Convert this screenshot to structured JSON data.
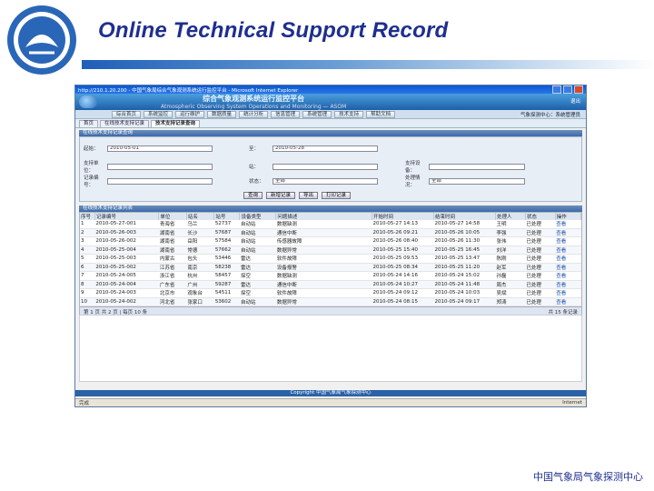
{
  "slide": {
    "title": "Online Technical Support Record",
    "footer": "中国气象局气象探测中心"
  },
  "colors": {
    "title": "#1f2f8f",
    "header": "#1e5fa8",
    "rule": "#1f5fb8"
  },
  "browser": {
    "title": "http://210.1.20.200 - 中国气象局综合气象观测系统运行监控平台 - Microsoft Internet Explorer"
  },
  "app": {
    "name_cn": "综合气象观测系统运行监控平台",
    "name_en": "Atmospheric Observing System Operations and Monitoring — ASOM",
    "logout": "退出",
    "menu": [
      "综合首页",
      "系统监控",
      "运行维护",
      "数据质量",
      "统计分析",
      "信息管理",
      "系统管理",
      "技术支持",
      "帮助文档"
    ],
    "user": "气象探测中心：系统管理员",
    "tabs": [
      "首页",
      "在线技术支持记录",
      "技术支持记录查询"
    ]
  },
  "form": {
    "header": "在线技术支持记录查询",
    "rows": [
      {
        "l1": "起始：",
        "v1": "2010-05-01",
        "l2": "至：",
        "v2": "2010-05-28"
      },
      {
        "l1": "支持单位：",
        "v1": "",
        "l2": "站：",
        "v2": "",
        "l3": "支持设备：",
        "v3": ""
      },
      {
        "l1": "记录编号：",
        "v1": "",
        "l2": "状态：",
        "v2": "全部",
        "l3": "处理情况：",
        "v3": "全部"
      }
    ],
    "buttons": [
      "查询",
      "新增记录",
      "导出",
      "打印记录"
    ]
  },
  "grid": {
    "header": "在线技术支持记录列表",
    "columns": [
      "序号",
      "记录编号",
      "单位",
      "站名",
      "站号",
      "设备类型",
      "问题描述",
      "开始时间",
      "结束时间",
      "处理人",
      "状态",
      "操作"
    ],
    "rows": [
      [
        "1",
        "2010-05-27-001",
        "青海省",
        "乌兰",
        "52737",
        "自动站",
        "数据缺测",
        "2010-05-27 14:13",
        "2010-05-27 14:58",
        "王明",
        "已处理",
        "查看"
      ],
      [
        "2",
        "2010-05-26-003",
        "湖南省",
        "长沙",
        "57687",
        "自动站",
        "通信中断",
        "2010-05-26 09:21",
        "2010-05-26 10:05",
        "李强",
        "已处理",
        "查看"
      ],
      [
        "3",
        "2010-05-26-002",
        "湖南省",
        "岳阳",
        "57584",
        "自动站",
        "传感器故障",
        "2010-05-26 08:40",
        "2010-05-26 11:30",
        "张伟",
        "已处理",
        "查看"
      ],
      [
        "4",
        "2010-05-25-004",
        "湖南省",
        "常德",
        "57662",
        "自动站",
        "数据异常",
        "2010-05-25 15:40",
        "2010-05-25 16:45",
        "刘洋",
        "已处理",
        "查看"
      ],
      [
        "5",
        "2010-05-25-003",
        "内蒙古",
        "包头",
        "53446",
        "雷达",
        "软件故障",
        "2010-05-25 09:53",
        "2010-05-25 13:47",
        "陈刚",
        "已处理",
        "查看"
      ],
      [
        "6",
        "2010-05-25-002",
        "江苏省",
        "南京",
        "58238",
        "雷达",
        "设备报警",
        "2010-05-25 08:34",
        "2010-05-25 11:20",
        "赵军",
        "已处理",
        "查看"
      ],
      [
        "7",
        "2010-05-24-005",
        "浙江省",
        "杭州",
        "58457",
        "探空",
        "数据缺测",
        "2010-05-24 14:16",
        "2010-05-24 15:02",
        "孙磊",
        "已处理",
        "查看"
      ],
      [
        "8",
        "2010-05-24-004",
        "广东省",
        "广州",
        "59287",
        "雷达",
        "通信中断",
        "2010-05-24 10:27",
        "2010-05-24 11:48",
        "周杰",
        "已处理",
        "查看"
      ],
      [
        "9",
        "2010-05-24-003",
        "北京市",
        "观象台",
        "54511",
        "探空",
        "软件故障",
        "2010-05-24 09:12",
        "2010-05-24 10:03",
        "吴斌",
        "已处理",
        "查看"
      ],
      [
        "10",
        "2010-05-24-002",
        "河北省",
        "张家口",
        "53602",
        "自动站",
        "数据异常",
        "2010-05-24 08:15",
        "2010-05-24 09:17",
        "郑涛",
        "已处理",
        "查看"
      ]
    ],
    "pager_left": "第 1 页 共 2 页 | 每页 10 条",
    "pager_right": "共 15 条记录"
  },
  "copyright": "Copyright 中国气象局气象探测中心",
  "status": {
    "left": "完成",
    "right": "Internet"
  }
}
